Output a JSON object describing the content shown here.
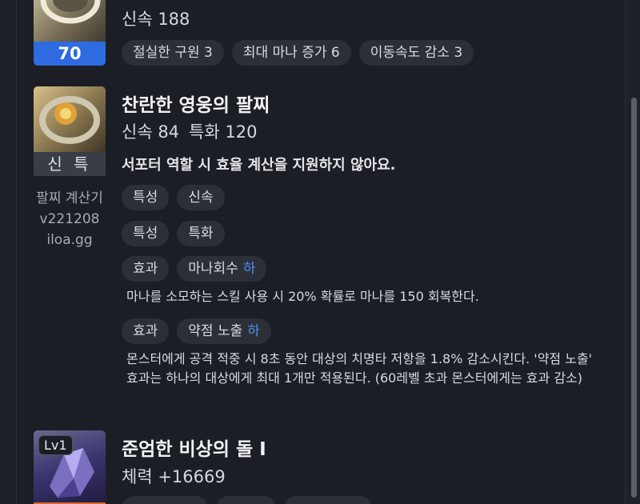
{
  "item1": {
    "stat": "신속 188",
    "level_badge": "70",
    "engravings": [
      "절실한 구원 3",
      "최대 마나 증가 6",
      "이동속도 감소 3"
    ]
  },
  "item2": {
    "title": "찬란한 영웅의 팔찌",
    "stats": [
      "신속 84",
      "특화 120"
    ],
    "badge": "신 특",
    "note": "서포터 역할 시 효율 계산을 지원하지 않아요.",
    "calculator": [
      "팔찌 계산기",
      "v221208",
      "iloa.gg"
    ],
    "options": [
      {
        "type": "특성",
        "name": "신속"
      },
      {
        "type": "특성",
        "name": "특화"
      },
      {
        "type": "효과",
        "name": "마나회수",
        "grade": "하",
        "desc": "마나를 소모하는 스킬 사용 시 20% 확률로 마나를 150 회복한다."
      },
      {
        "type": "효과",
        "name": "약점 노출",
        "grade": "하",
        "desc": "몬스터에게 공격 적중 시 8초 동안 대상의 치명타 저항을 1.8% 감소시킨다. '약점 노출' 효과는 하나의 대상에게 최대 1개만 적용된다. (60레벨 초과 몬스터에게는 효과 감소)"
      }
    ]
  },
  "item3": {
    "level": "Lv1",
    "title": "준엄한 비상의 돌 I",
    "stat": "체력 +16669"
  },
  "colors": {
    "background": "#1c1e25",
    "chip": "#2c2f38",
    "grade_accent": "#4f8ff0",
    "level_badge_bg": "#2e6be0",
    "stone_badge_bg": "#d9682a"
  },
  "icons": [
    "ring-icon",
    "bracelet-icon",
    "ability-stone-icon"
  ]
}
